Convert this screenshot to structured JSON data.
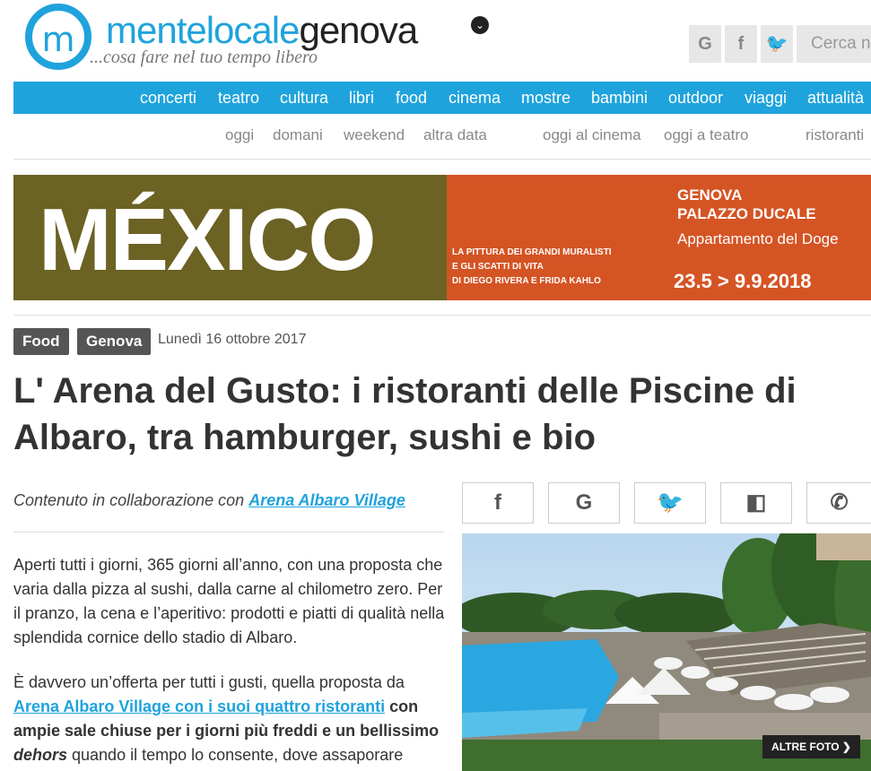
{
  "header": {
    "logo_letter": "m",
    "brand_part1": "mentelocale",
    "brand_part2": "genova",
    "brand_chevron": "⌄",
    "tagline": "...cosa fare nel tuo tempo libero",
    "social": [
      {
        "icon": "google-icon",
        "glyph": "G"
      },
      {
        "icon": "facebook-icon",
        "glyph": "f"
      },
      {
        "icon": "twitter-icon",
        "glyph": "🐦"
      }
    ],
    "search_placeholder": "Cerca n"
  },
  "nav": {
    "items": [
      "concerti",
      "teatro",
      "cultura",
      "libri",
      "food",
      "cinema",
      "mostre",
      "bambini",
      "outdoor",
      "viaggi",
      "attualità"
    ],
    "sub_items": [
      "oggi",
      "domani",
      "weekend",
      "altra data",
      "oggi al cinema",
      "oggi a teatro",
      "ristoranti"
    ]
  },
  "banner": {
    "title": "MÉXICO",
    "subtitle_line1": "LA PITTURA DEI GRANDI MURALISTI",
    "subtitle_line2": "E GLI SCATTI DI VITA",
    "subtitle_line3": "DI DIEGO RIVERA E FRIDA KAHLO",
    "city": "GENOVA",
    "venue": "PALAZZO DUCALE",
    "room": "Appartamento del Doge",
    "dates": "23.5 > 9.9.2018"
  },
  "article": {
    "tags": [
      "Food",
      "Genova"
    ],
    "date": "Lunedì 16 ottobre 2017",
    "title": "L' Arena del Gusto: i ristoranti delle Piscine di Albaro, tra hamburger, sushi e bio",
    "sponsor_prefix": "Contenuto in collaborazione con ",
    "sponsor_link": "Arena Albaro Village",
    "para1": "Aperti tutti i giorni, 365 giorni all’anno, con una proposta che varia dalla pizza al sushi, dalla carne al chilometro zero. Per il pranzo, la cena e l’aperitivo: prodotti e piatti di qualità nella splendida cornice dello stadio di Albaro.",
    "para2_start": "È davvero un’offerta per tutti i gusti, quella proposta da ",
    "para2_link": "Arena Albaro Village con i suoi quattro ristoranti",
    "para2_bold": " con ampie sale chiuse per i giorni più freddi e un bellissimo ",
    "para2_italic": "dehors",
    "para2_end": " quando il tempo lo consente, dove assaporare",
    "share": [
      {
        "icon": "facebook-icon",
        "glyph": "f"
      },
      {
        "icon": "google-icon",
        "glyph": "G"
      },
      {
        "icon": "twitter-icon",
        "glyph": "🐦"
      },
      {
        "icon": "delicious-icon",
        "glyph": "◧"
      },
      {
        "icon": "whatsapp-icon",
        "glyph": "✆"
      }
    ],
    "photo_button": "ALTRE FOTO ❯"
  },
  "colors": {
    "brand_blue": "#1fa3dc",
    "banner_olive": "#6b6223",
    "banner_orange": "#d55424",
    "tag_gray": "#555555"
  }
}
